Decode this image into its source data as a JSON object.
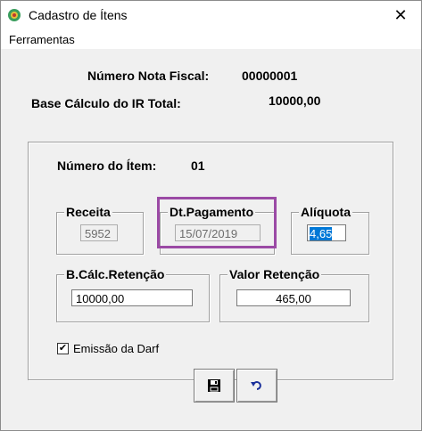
{
  "window": {
    "title": "Cadastro de Ítens",
    "close_label": "✕"
  },
  "menu": {
    "tools": "Ferramentas"
  },
  "header": {
    "nota_label": "Número Nota Fiscal:",
    "nota_value": "00000001",
    "base_label": "Base Cálculo do IR Total:",
    "base_value": "10000,00"
  },
  "item": {
    "label": "Número do Ítem:",
    "value": "01"
  },
  "receita": {
    "label": "Receita",
    "value": "5952"
  },
  "dt_pagamento": {
    "label": "Dt.Pagamento",
    "value": "15/07/2019"
  },
  "aliquota": {
    "label": "Alíquota",
    "value": "4,65"
  },
  "bcalc": {
    "label": "B.Cálc.Retenção",
    "value": "10000,00"
  },
  "valor": {
    "label": "Valor Retenção",
    "value": "465,00"
  },
  "darf": {
    "label": "Emissão da Darf",
    "checked": true,
    "check_glyph": "✔"
  },
  "colors": {
    "highlight": "#9b4aa5",
    "selection": "#0078d7"
  },
  "icons": {
    "app": "app-icon",
    "save": "save-icon",
    "undo": "undo-icon"
  }
}
